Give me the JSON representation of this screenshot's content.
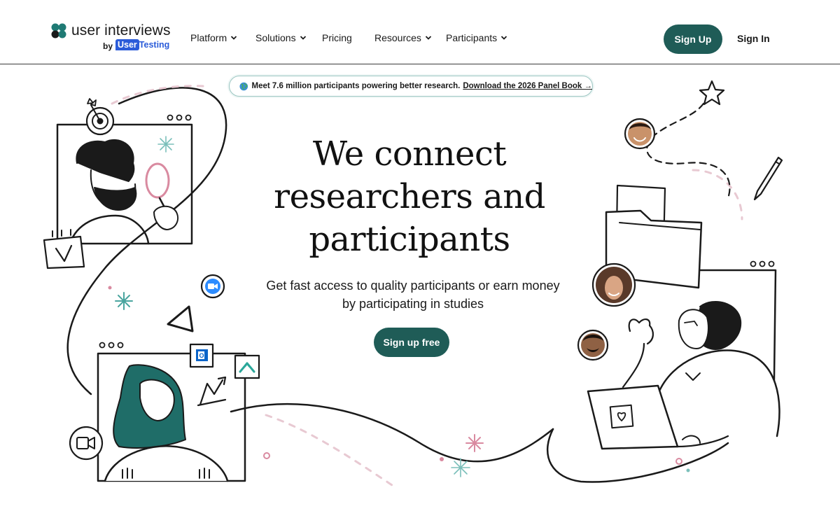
{
  "brand": {
    "name": "user interviews",
    "by": "by",
    "sub_user": "User",
    "sub_testing": "Testing"
  },
  "nav": {
    "items": [
      {
        "label": "Platform",
        "has_dropdown": true
      },
      {
        "label": "Solutions",
        "has_dropdown": true
      },
      {
        "label": "Pricing",
        "has_dropdown": false
      },
      {
        "label": "Resources",
        "has_dropdown": true
      },
      {
        "label": "Participants",
        "has_dropdown": true
      }
    ],
    "signup_label": "Sign Up",
    "signin_label": "Sign In"
  },
  "banner": {
    "icon": "globe-icon",
    "text": "Meet 7.6 million participants powering better research.",
    "link_text": "Download the 2026 Panel Book →"
  },
  "hero": {
    "title_line1": "We connect",
    "title_line2": "researchers and",
    "title_line3": "participants",
    "subtitle": "Get fast access to quality participants or earn money by participating in studies",
    "cta_label": "Sign up free"
  },
  "colors": {
    "primary": "#1f5c57",
    "accent_teal": "#1f7a74",
    "accent_pink": "#d98aa0",
    "usertesting_blue": "#2b5cd9"
  },
  "icons": [
    "target-icon",
    "magnifying-glass-icon",
    "calendar-icon",
    "zoom-icon",
    "play-triangle-icon",
    "outlook-icon",
    "ms-teams-icon",
    "trend-chart-icon",
    "video-camera-icon",
    "star-icon",
    "pencil-icon",
    "folder-icon",
    "heart-icon",
    "sparkle-icon"
  ]
}
